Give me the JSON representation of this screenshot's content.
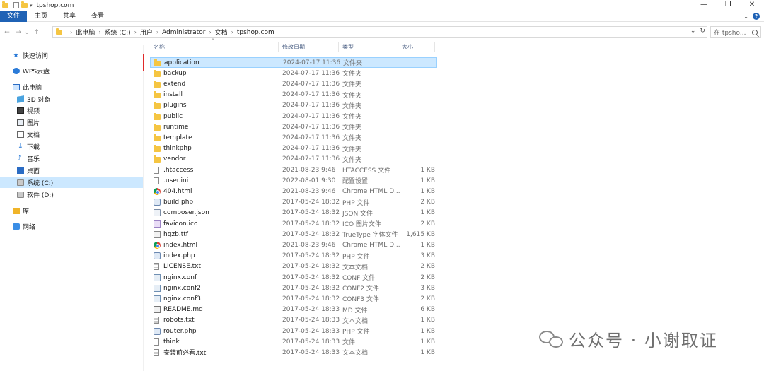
{
  "window": {
    "title": "tpshop.com"
  },
  "window_controls": {
    "minimize": "—",
    "maximize": "❐",
    "close": "✕"
  },
  "ribbon": {
    "tabs": [
      "文件",
      "主页",
      "共享",
      "查看"
    ],
    "collapse": "⌄",
    "help": "?"
  },
  "nav": {
    "back": "←",
    "forward": "→",
    "recent": "⌄",
    "up": "↑",
    "breadcrumbs": [
      "此电脑",
      "系统 (C:)",
      "用户",
      "Administrator",
      "文档",
      "tpshop.com"
    ],
    "dropdown": "⌄",
    "refresh": "↻",
    "search_placeholder": "在 tpsho..."
  },
  "sidebar": {
    "items": [
      {
        "label": "快速访问",
        "icon": "star-icon"
      },
      {
        "label": "WPS云盘",
        "icon": "cloud-icon"
      },
      {
        "label": "此电脑",
        "icon": "computer-icon"
      },
      {
        "label": "3D 对象",
        "icon": "3d-objects-icon"
      },
      {
        "label": "视频",
        "icon": "video-icon"
      },
      {
        "label": "图片",
        "icon": "picture-icon"
      },
      {
        "label": "文档",
        "icon": "document-icon"
      },
      {
        "label": "下载",
        "icon": "download-icon"
      },
      {
        "label": "音乐",
        "icon": "music-icon"
      },
      {
        "label": "桌面",
        "icon": "desktop-icon"
      },
      {
        "label": "系统 (C:)",
        "icon": "drive-icon",
        "selected": true
      },
      {
        "label": "软件 (D:)",
        "icon": "drive-icon"
      },
      {
        "label": "库",
        "icon": "library-icon"
      },
      {
        "label": "网络",
        "icon": "network-icon"
      }
    ]
  },
  "columns": {
    "name": "名称",
    "date": "修改日期",
    "type": "类型",
    "size": "大小",
    "sort_indicator": "^"
  },
  "files": [
    {
      "name": "application",
      "date": "2024-07-17 11:36",
      "type": "文件夹",
      "size": "",
      "icon": "folder",
      "selected": true
    },
    {
      "name": "backup",
      "date": "2024-07-17 11:36",
      "type": "文件夹",
      "size": "",
      "icon": "folder"
    },
    {
      "name": "extend",
      "date": "2024-07-17 11:36",
      "type": "文件夹",
      "size": "",
      "icon": "folder"
    },
    {
      "name": "install",
      "date": "2024-07-17 11:36",
      "type": "文件夹",
      "size": "",
      "icon": "folder"
    },
    {
      "name": "plugins",
      "date": "2024-07-17 11:36",
      "type": "文件夹",
      "size": "",
      "icon": "folder"
    },
    {
      "name": "public",
      "date": "2024-07-17 11:36",
      "type": "文件夹",
      "size": "",
      "icon": "folder"
    },
    {
      "name": "runtime",
      "date": "2024-07-17 11:36",
      "type": "文件夹",
      "size": "",
      "icon": "folder"
    },
    {
      "name": "template",
      "date": "2024-07-17 11:36",
      "type": "文件夹",
      "size": "",
      "icon": "folder"
    },
    {
      "name": "thinkphp",
      "date": "2024-07-17 11:36",
      "type": "文件夹",
      "size": "",
      "icon": "folder"
    },
    {
      "name": "vendor",
      "date": "2024-07-17 11:36",
      "type": "文件夹",
      "size": "",
      "icon": "folder"
    },
    {
      "name": ".htaccess",
      "date": "2021-08-23 9:46",
      "type": "HTACCESS 文件",
      "size": "1 KB",
      "icon": "file"
    },
    {
      "name": ".user.ini",
      "date": "2022-08-01 9:30",
      "type": "配置设置",
      "size": "1 KB",
      "icon": "file"
    },
    {
      "name": "404.html",
      "date": "2021-08-23 9:46",
      "type": "Chrome HTML D...",
      "size": "1 KB",
      "icon": "chrome"
    },
    {
      "name": "build.php",
      "date": "2017-05-24 18:32",
      "type": "PHP 文件",
      "size": "2 KB",
      "icon": "php"
    },
    {
      "name": "composer.json",
      "date": "2017-05-24 18:32",
      "type": "JSON 文件",
      "size": "1 KB",
      "icon": "json"
    },
    {
      "name": "favicon.ico",
      "date": "2017-05-24 18:32",
      "type": "ICO 图片文件",
      "size": "2 KB",
      "icon": "ico"
    },
    {
      "name": "hgzb.ttf",
      "date": "2017-05-24 18:32",
      "type": "TrueType 字体文件",
      "size": "1,615 KB",
      "icon": "font"
    },
    {
      "name": "index.html",
      "date": "2021-08-23 9:46",
      "type": "Chrome HTML D...",
      "size": "1 KB",
      "icon": "chrome"
    },
    {
      "name": "index.php",
      "date": "2017-05-24 18:32",
      "type": "PHP 文件",
      "size": "3 KB",
      "icon": "php"
    },
    {
      "name": "LICENSE.txt",
      "date": "2017-05-24 18:32",
      "type": "文本文档",
      "size": "2 KB",
      "icon": "txt"
    },
    {
      "name": "nginx.conf",
      "date": "2017-05-24 18:32",
      "type": "CONF 文件",
      "size": "2 KB",
      "icon": "conf"
    },
    {
      "name": "nginx.conf2",
      "date": "2017-05-24 18:32",
      "type": "CONF2 文件",
      "size": "3 KB",
      "icon": "conf"
    },
    {
      "name": "nginx.conf3",
      "date": "2017-05-24 18:32",
      "type": "CONF3 文件",
      "size": "2 KB",
      "icon": "conf"
    },
    {
      "name": "README.md",
      "date": "2017-05-24 18:33",
      "type": "MD 文件",
      "size": "6 KB",
      "icon": "md"
    },
    {
      "name": "robots.txt",
      "date": "2017-05-24 18:33",
      "type": "文本文档",
      "size": "1 KB",
      "icon": "txt"
    },
    {
      "name": "router.php",
      "date": "2017-05-24 18:33",
      "type": "PHP 文件",
      "size": "1 KB",
      "icon": "php"
    },
    {
      "name": "think",
      "date": "2017-05-24 18:33",
      "type": "文件",
      "size": "1 KB",
      "icon": "file"
    },
    {
      "name": "安装前必看.txt",
      "date": "2017-05-24 18:33",
      "type": "文本文档",
      "size": "1 KB",
      "icon": "txt"
    }
  ],
  "watermark": {
    "text": "公众号 · 小谢取证"
  },
  "colors": {
    "accent": "#1f62b5",
    "selection": "#cce8ff",
    "highlight_box": "#e02a2a"
  }
}
